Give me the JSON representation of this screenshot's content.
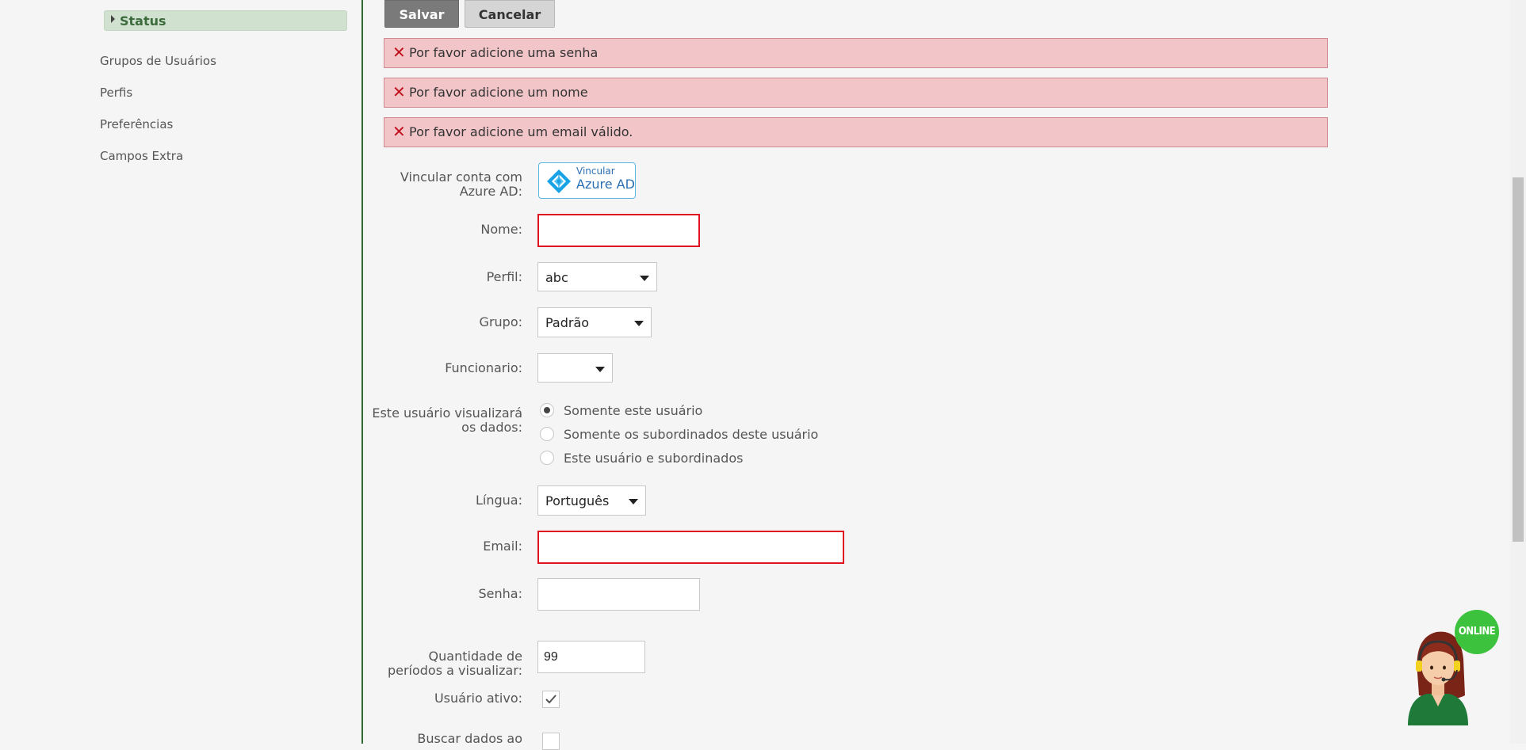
{
  "sidebar": {
    "active_item": "Status",
    "items": [
      {
        "label": "Grupos de Usuários"
      },
      {
        "label": "Perfis"
      },
      {
        "label": "Preferências"
      },
      {
        "label": "Campos Extra"
      }
    ]
  },
  "toolbar": {
    "save_label": "Salvar",
    "cancel_label": "Cancelar"
  },
  "errors": [
    "Por favor adicione uma senha",
    "Por favor adicione um nome",
    "Por favor adicione um email válido."
  ],
  "form": {
    "azure": {
      "label_line1": "Vincular conta com",
      "label_line2": "Azure AD:",
      "button_small": "Vincular",
      "button_large": "Azure AD"
    },
    "nome": {
      "label": "Nome:",
      "value": ""
    },
    "perfil": {
      "label": "Perfil:",
      "value": "abc"
    },
    "grupo": {
      "label": "Grupo:",
      "value": "Padrão"
    },
    "funcionario": {
      "label": "Funcionario:",
      "value": ""
    },
    "visibility": {
      "label_line1": "Este usuário visualizará",
      "label_line2": "os dados:",
      "options": [
        {
          "label": "Somente este usuário",
          "selected": true
        },
        {
          "label": "Somente os subordinados deste usuário",
          "selected": false
        },
        {
          "label": "Este usuário e subordinados",
          "selected": false
        }
      ]
    },
    "lingua": {
      "label": "Língua:",
      "value": "Português"
    },
    "email": {
      "label": "Email:",
      "value": ""
    },
    "senha": {
      "label": "Senha:",
      "value": ""
    },
    "periodos": {
      "label_line1": "Quantidade de",
      "label_line2": "períodos a visualizar:",
      "value": "99"
    },
    "usuario_ativo": {
      "label": "Usuário ativo:",
      "checked": true
    },
    "buscar_dados": {
      "label": "Buscar dados ao",
      "checked": false
    }
  },
  "chat": {
    "badge": "ONLINE"
  },
  "colors": {
    "accent_green": "#2e6b2e",
    "error_bg": "#f2c6c9",
    "error_icon": "#c0121d",
    "invalid_border": "#e0141e",
    "azure_blue": "#2b6fb3",
    "online_green": "#3cc23c"
  },
  "icons": [
    "caret-right-icon",
    "close-icon",
    "azure-ad-icon",
    "chevron-down-icon",
    "check-icon",
    "support-agent-icon"
  ]
}
